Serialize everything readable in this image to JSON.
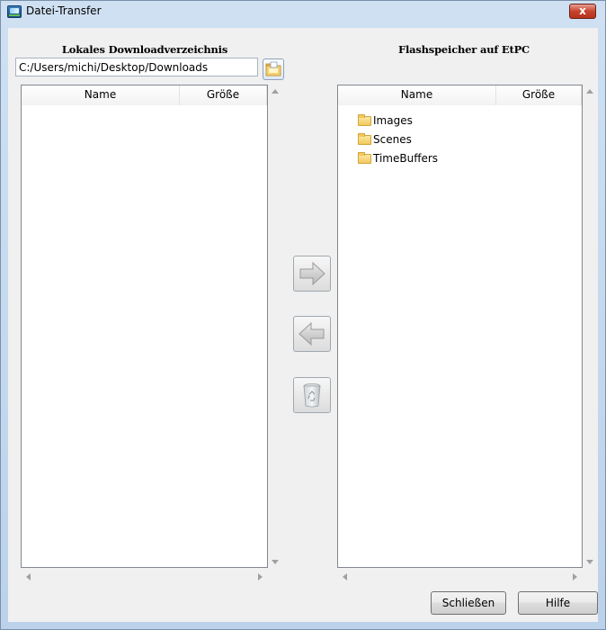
{
  "window": {
    "title": "Datei-Transfer",
    "close_label": "x"
  },
  "local_pane": {
    "title": "Lokales Downloadverzeichnis",
    "path_value": "C:/Users/michi/Desktop/Downloads",
    "columns": {
      "name": "Name",
      "size": "Größe"
    },
    "items": []
  },
  "remote_pane": {
    "title": "Flashspeicher auf EtPC",
    "columns": {
      "name": "Name",
      "size": "Größe"
    },
    "items": [
      {
        "name": "Images",
        "icon": "folder-icon"
      },
      {
        "name": "Scenes",
        "icon": "folder-icon"
      },
      {
        "name": "TimeBuffers",
        "icon": "folder-icon"
      }
    ]
  },
  "transfer_buttons": {
    "to_remote_icon": "arrow-right-icon",
    "to_local_icon": "arrow-left-icon",
    "delete_icon": "recycle-bin-icon"
  },
  "footer": {
    "close_label": "Schließen",
    "help_label": "Hilfe"
  }
}
